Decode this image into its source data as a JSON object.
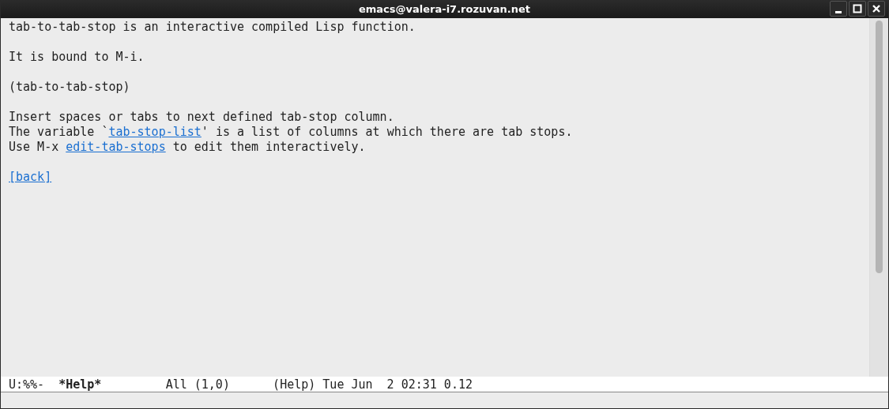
{
  "window": {
    "title": "emacs@valera-i7.rozuvan.net"
  },
  "buffer": {
    "paragraphs": [
      [
        [
          {
            "kind": "text",
            "text": "tab-to-tab-stop is an interactive compiled Lisp function."
          }
        ]
      ],
      [
        [
          {
            "kind": "text",
            "text": "It is bound to M-i."
          }
        ]
      ],
      [
        [
          {
            "kind": "text",
            "text": "(tab-to-tab-stop)"
          }
        ]
      ],
      [
        [
          {
            "kind": "text",
            "text": "Insert spaces or tabs to next defined tab-stop column."
          }
        ],
        [
          {
            "kind": "text",
            "text": "The variable `"
          },
          {
            "kind": "link",
            "text": "tab-stop-list"
          },
          {
            "kind": "text",
            "text": "' is a list of columns at which there are tab stops."
          }
        ],
        [
          {
            "kind": "text",
            "text": "Use M-x "
          },
          {
            "kind": "link",
            "text": "edit-tab-stops"
          },
          {
            "kind": "text",
            "text": " to edit them interactively."
          }
        ]
      ],
      [
        [
          {
            "kind": "link",
            "text": "[back]"
          }
        ]
      ]
    ]
  },
  "mode_line": [
    {
      "text": "U:%%-",
      "bold": false
    },
    {
      "text": "*Help*",
      "bold": true
    },
    {
      "text": "All (1,0)",
      "bold": false
    },
    {
      "text": "(Help) Tue Jun  2 02:31 0.12",
      "bold": false
    }
  ]
}
